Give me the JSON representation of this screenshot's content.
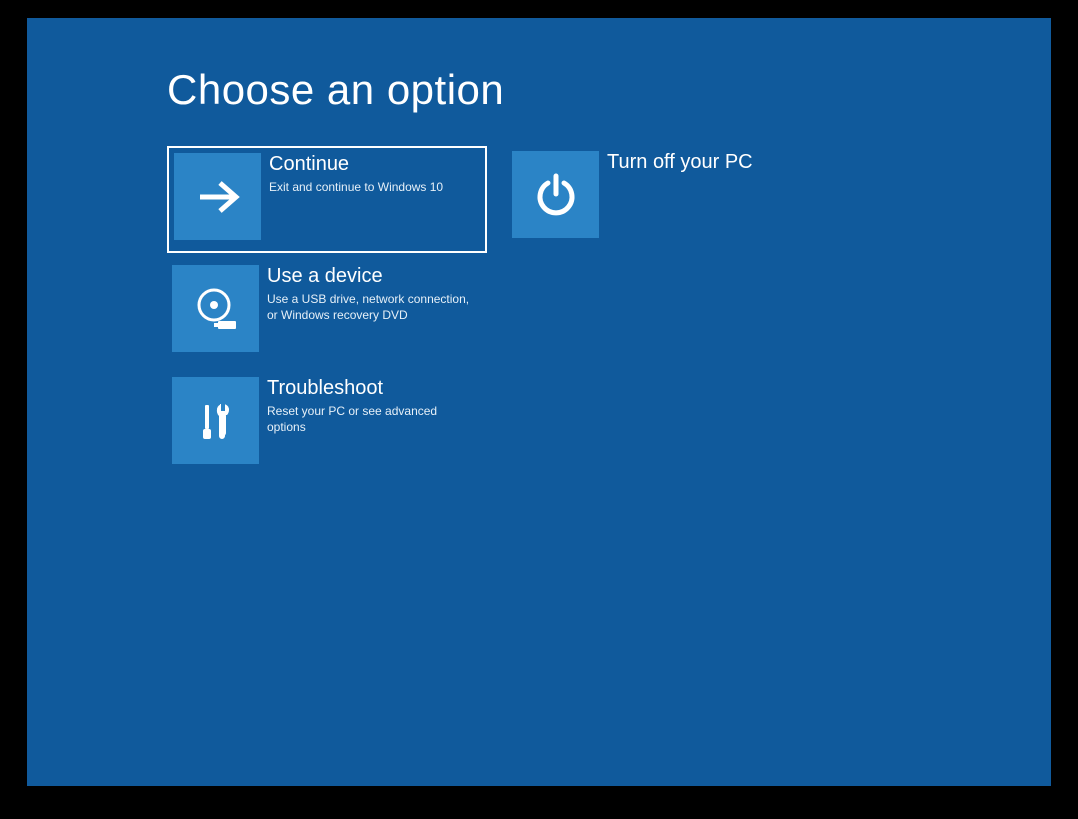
{
  "title": "Choose an option",
  "options": {
    "continue": {
      "title": "Continue",
      "desc": "Exit and continue to Windows 10"
    },
    "use_device": {
      "title": "Use a device",
      "desc": "Use a USB drive, network connection, or Windows recovery DVD"
    },
    "troubleshoot": {
      "title": "Troubleshoot",
      "desc": "Reset your PC or see advanced options"
    },
    "turn_off": {
      "title": "Turn off your PC"
    }
  }
}
